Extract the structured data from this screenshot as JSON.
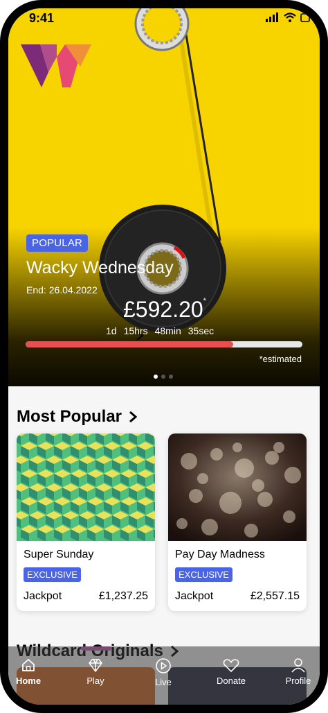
{
  "status": {
    "time": "9:41"
  },
  "hero": {
    "badge": "POPULAR",
    "title": "Wacky Wednesday",
    "end": "End: 26.04.2022",
    "amount": "£592.20",
    "amount_mark": "*",
    "countdown": [
      "1d",
      "15hrs",
      "48min",
      "35sec"
    ],
    "progress": 0.75,
    "estimated": "*estimated",
    "carousel_dots": 3,
    "carousel_active": 0
  },
  "most_popular": {
    "title": "Most Popular",
    "cards": [
      {
        "title": "Super Sunday",
        "badge": "EXCLUSIVE",
        "jackpot_label": "Jackpot",
        "jackpot_value": "£1,237.25"
      },
      {
        "title": "Pay Day Madness",
        "badge": "EXCLUSIVE",
        "jackpot_label": "Jackpot",
        "jackpot_value": "£2,557.15"
      }
    ]
  },
  "originals": {
    "title": "Wildcard Originals"
  },
  "nav": {
    "items": [
      {
        "label": "Home",
        "icon": "home-icon",
        "active": true
      },
      {
        "label": "Play",
        "icon": "diamond-icon",
        "active": false
      },
      {
        "label": "Live",
        "icon": "play-icon",
        "active": false
      },
      {
        "label": "Donate",
        "icon": "heart-icon",
        "active": false
      },
      {
        "label": "Profile",
        "icon": "user-icon",
        "active": false
      }
    ]
  },
  "colors": {
    "hero_yellow": "#f7d300",
    "badge_blue": "#4964e6",
    "progress_red": "#e85050"
  }
}
